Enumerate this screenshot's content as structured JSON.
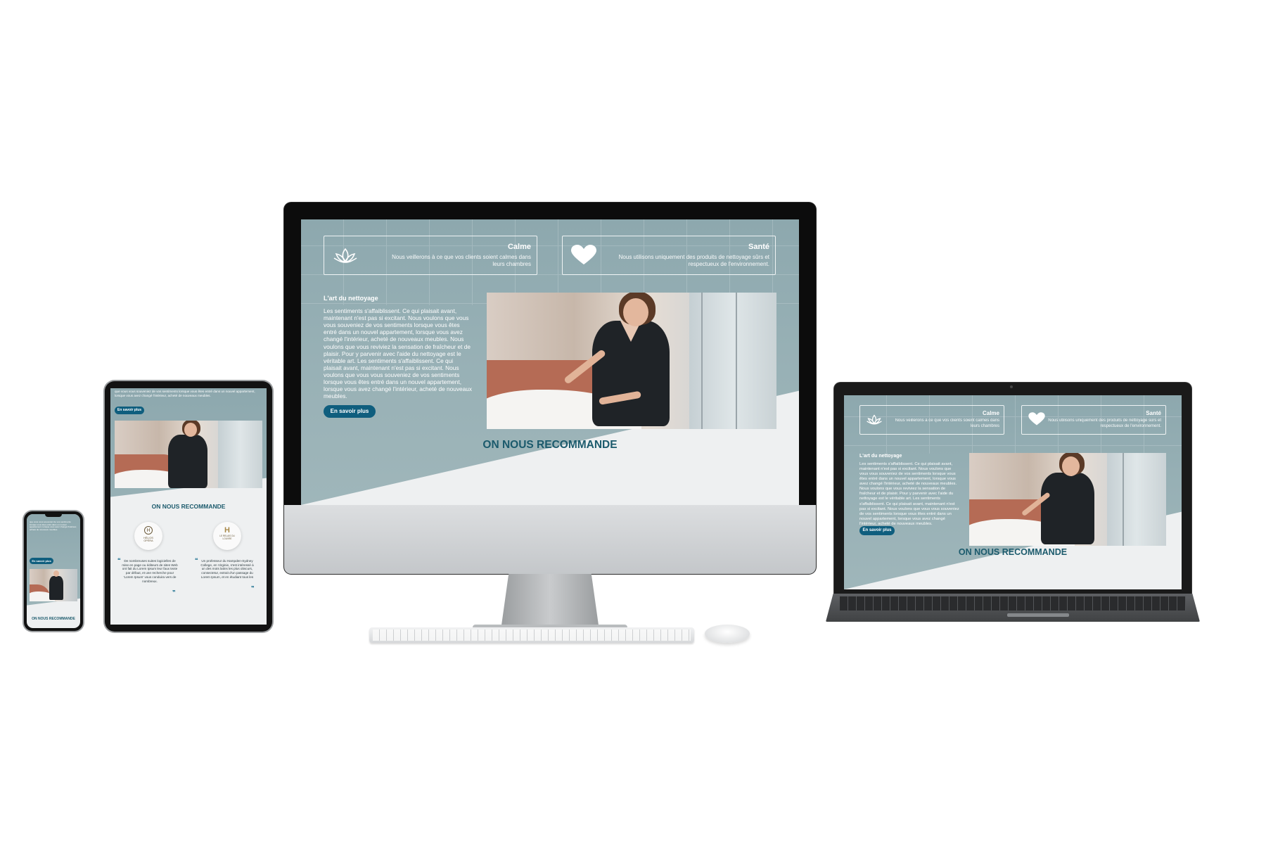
{
  "site": {
    "cards": [
      {
        "title": "Calme",
        "description": "Nous veillerons à ce que vos clients soient calmes dans leurs chambres",
        "icon": "lotus-icon"
      },
      {
        "title": "Santé",
        "description": "Nous utilisons uniquement des produits de nettoyage sûrs et respectueux de l'environnement.",
        "icon": "heart-icon"
      }
    ],
    "section_title": "L'art du nettoyage",
    "paragraph": "Les sentiments s'affaiblissent. Ce qui plaisait avant, maintenant n'est pas si excitant. Nous voulons que vous vous souveniez de vos sentiments lorsque vous êtes entré dans un nouvel appartement, lorsque vous avez changé l'intérieur, acheté de nouveaux meubles. Nous voulons que vous reviviez la sensation de fraîcheur et de plaisir. Pour y parvenir avec l'aide du nettoyage est le véritable art. Les sentiments s'affaiblissent. Ce qui plaisait avant, maintenant n'est pas si excitant. Nous voulons que vous vous souveniez de vos sentiments lorsque vous êtes entré dans un nouvel appartement, lorsque vous avez changé l'intérieur, acheté de nouveaux meubles.",
    "tablet_intro": "que vous vous souveniez de vos sentiments lorsque vous êtes entré dans un nouvel appartement, lorsque vous avez changé l'intérieur, acheté de nouveaux meubles.",
    "button_label": "En savoir plus",
    "recommend_title": "ON NOUS RECOMMANDE",
    "partners": [
      {
        "name": "HÉLIOS OPÉRA",
        "monogram": "H"
      },
      {
        "name": "LE RELAIS DU LOUVRE",
        "monogram": "H"
      }
    ],
    "testimonials": [
      "De nombreuses suites logicielles de mise en page ou éditeurs de sites Web ont fait du Lorem Ipsum leur faux texte par défaut, et une recherche pour 'Lorem Ipsum' vous conduira vers de nombreux.",
      "Un professeur du Hampden-Sydney College, en Virginie, s'est intéressé à un des mots latins les plus obscurs, consectetur, extrait d'un passage du Lorem Ipsum, et en étudiant tous les"
    ]
  },
  "colors": {
    "teal_bg": "#97b0b5",
    "button": "#0f5e7e",
    "recommend_text": "#1b5a6c",
    "page_bg": "#eef0f1"
  }
}
